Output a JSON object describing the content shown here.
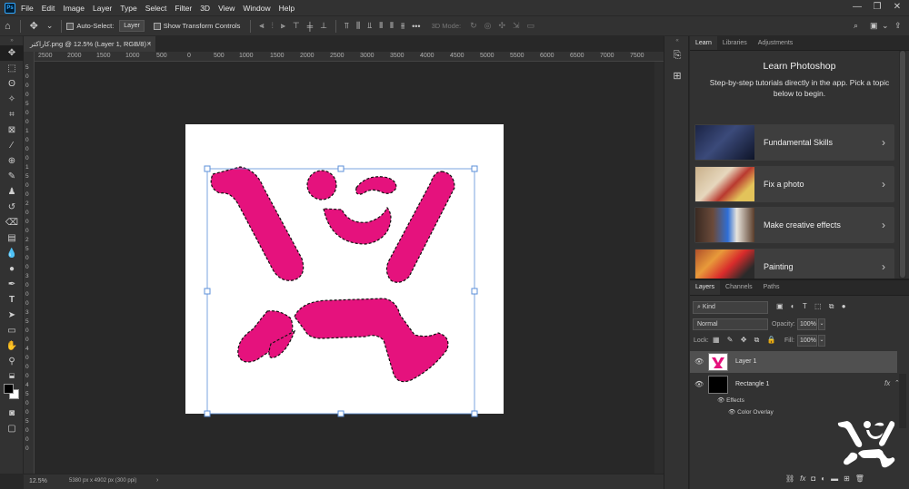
{
  "menu": [
    "File",
    "Edit",
    "Image",
    "Layer",
    "Type",
    "Select",
    "Filter",
    "3D",
    "View",
    "Window",
    "Help"
  ],
  "options": {
    "auto_select_label": "Auto-Select:",
    "auto_select_value": "Layer",
    "transform_label": "Show Transform Controls",
    "mode_3d": "3D Mode:"
  },
  "document": {
    "tab_title": "کاراکتر.png @ 12.5% (Layer 1, RGB/8) *",
    "zoom": "12.5%",
    "size_info": "5380 px x 4902 px (300 ppi)"
  },
  "ruler_h": [
    "2500",
    "2000",
    "1500",
    "1000",
    "500",
    "0",
    "500",
    "1000",
    "1500",
    "2000",
    "2500",
    "3000",
    "3500",
    "4000",
    "4500",
    "5000",
    "5500",
    "6000",
    "6500",
    "7000",
    "7500"
  ],
  "ruler_v": [
    "5",
    "0",
    "0",
    "0",
    "5",
    "0",
    "0",
    "1",
    "0",
    "0",
    "0",
    "1",
    "5",
    "0",
    "0",
    "2",
    "0",
    "0",
    "0",
    "2",
    "5",
    "0",
    "0",
    "3",
    "0",
    "0",
    "0",
    "3",
    "5",
    "0",
    "0",
    "4",
    "0",
    "0",
    "0",
    "4",
    "5",
    "0",
    "0",
    "5",
    "0",
    "0",
    "0"
  ],
  "learn_panel": {
    "tabs": [
      "Learn",
      "Libraries",
      "Adjustments"
    ],
    "title": "Learn Photoshop",
    "description": "Step-by-step tutorials directly in the app. Pick a topic below to begin.",
    "cards": [
      {
        "label": "Fundamental Skills"
      },
      {
        "label": "Fix a photo"
      },
      {
        "label": "Make creative effects"
      },
      {
        "label": "Painting"
      }
    ]
  },
  "layers_panel": {
    "tabs": [
      "Layers",
      "Channels",
      "Paths"
    ],
    "filter_kind": "Kind",
    "blend_mode": "Normal",
    "opacity_label": "Opacity:",
    "opacity_value": "100%",
    "lock_label": "Lock:",
    "fill_label": "Fill:",
    "fill_value": "100%",
    "layers": [
      {
        "name": "Layer 1"
      },
      {
        "name": "Rectangle 1"
      }
    ],
    "effects_label": "Effects",
    "effect_item": "Color Overlay",
    "fx": "fx"
  },
  "colors": {
    "accent_pink": "#e5127d",
    "app_bg": "#282828",
    "panel_bg": "#323232"
  }
}
